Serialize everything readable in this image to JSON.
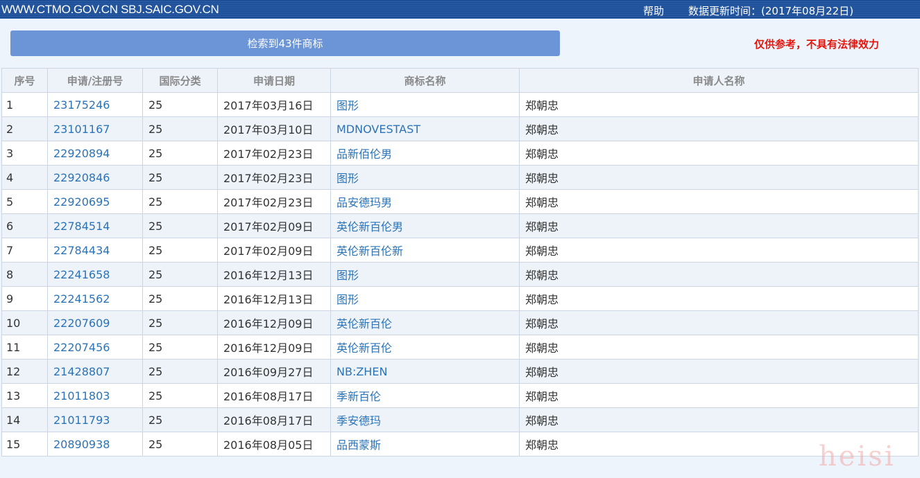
{
  "header": {
    "site": "WWW.CTMO.GOV.CN SBJ.SAIC.GOV.CN",
    "help": "帮助",
    "updated": "数据更新时间：(2017年08月22日)"
  },
  "result_summary": "检索到43件商标",
  "disclaimer": "仅供参考，不具有法律效力",
  "table": {
    "headers": {
      "seq": "序号",
      "reg_no": "申请/注册号",
      "intl_class": "国际分类",
      "app_date": "申请日期",
      "mark_name": "商标名称",
      "applicant": "申请人名称"
    },
    "rows": [
      {
        "seq": "1",
        "reg_no": "23175246",
        "intl_class": "25",
        "app_date": "2017年03月16日",
        "mark_name": "图形",
        "applicant": "郑朝忠"
      },
      {
        "seq": "2",
        "reg_no": "23101167",
        "intl_class": "25",
        "app_date": "2017年03月10日",
        "mark_name": "MDNOVESTAST",
        "applicant": "郑朝忠"
      },
      {
        "seq": "3",
        "reg_no": "22920894",
        "intl_class": "25",
        "app_date": "2017年02月23日",
        "mark_name": "品新佰伦男",
        "applicant": "郑朝忠"
      },
      {
        "seq": "4",
        "reg_no": "22920846",
        "intl_class": "25",
        "app_date": "2017年02月23日",
        "mark_name": "图形",
        "applicant": "郑朝忠"
      },
      {
        "seq": "5",
        "reg_no": "22920695",
        "intl_class": "25",
        "app_date": "2017年02月23日",
        "mark_name": "品安德玛男",
        "applicant": "郑朝忠"
      },
      {
        "seq": "6",
        "reg_no": "22784514",
        "intl_class": "25",
        "app_date": "2017年02月09日",
        "mark_name": "英伦新百伦男",
        "applicant": "郑朝忠"
      },
      {
        "seq": "7",
        "reg_no": "22784434",
        "intl_class": "25",
        "app_date": "2017年02月09日",
        "mark_name": "英伦新百伦新",
        "applicant": "郑朝忠"
      },
      {
        "seq": "8",
        "reg_no": "22241658",
        "intl_class": "25",
        "app_date": "2016年12月13日",
        "mark_name": "图形",
        "applicant": "郑朝忠"
      },
      {
        "seq": "9",
        "reg_no": "22241562",
        "intl_class": "25",
        "app_date": "2016年12月13日",
        "mark_name": "图形",
        "applicant": "郑朝忠"
      },
      {
        "seq": "10",
        "reg_no": "22207609",
        "intl_class": "25",
        "app_date": "2016年12月09日",
        "mark_name": "英伦新百伦",
        "applicant": "郑朝忠"
      },
      {
        "seq": "11",
        "reg_no": "22207456",
        "intl_class": "25",
        "app_date": "2016年12月09日",
        "mark_name": "英伦新百伦",
        "applicant": "郑朝忠"
      },
      {
        "seq": "12",
        "reg_no": "21428807",
        "intl_class": "25",
        "app_date": "2016年09月27日",
        "mark_name": "NB:ZHEN",
        "applicant": "郑朝忠"
      },
      {
        "seq": "13",
        "reg_no": "21011803",
        "intl_class": "25",
        "app_date": "2016年08月17日",
        "mark_name": "季新百伦",
        "applicant": "郑朝忠"
      },
      {
        "seq": "14",
        "reg_no": "21011793",
        "intl_class": "25",
        "app_date": "2016年08月17日",
        "mark_name": "季安德玛",
        "applicant": "郑朝忠"
      },
      {
        "seq": "15",
        "reg_no": "20890938",
        "intl_class": "25",
        "app_date": "2016年08月05日",
        "mark_name": "品西蒙斯",
        "applicant": "郑朝忠"
      }
    ]
  },
  "watermark": "heisi",
  "colors": {
    "header_bar": "#1f4f96",
    "result_bar": "#6b95d6",
    "link": "#2b73b8",
    "disclaimer": "#e1170f"
  }
}
